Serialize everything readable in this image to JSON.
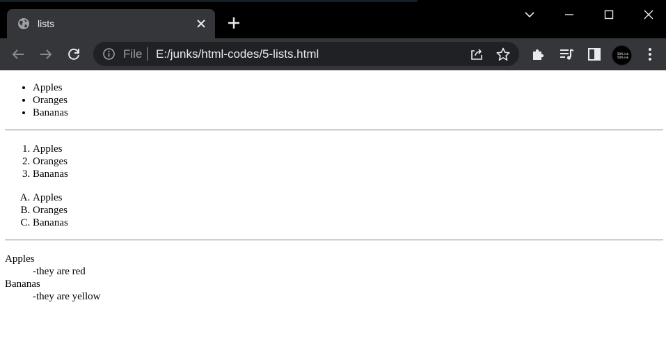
{
  "tab": {
    "title": "lists"
  },
  "omnibox": {
    "scheme": "File",
    "url": "E:/junks/html-codes/5-lists.html"
  },
  "avatar": {
    "line1": "50% ink",
    "line2": "50% ink"
  },
  "page": {
    "unordered": [
      "Apples",
      "Oranges",
      "Bananas"
    ],
    "ordered_numeric": [
      "Apples",
      "Oranges",
      "Bananas"
    ],
    "ordered_alpha": [
      "Apples",
      "Oranges",
      "Bananas"
    ],
    "definitions": [
      {
        "term": "Apples",
        "desc": "-they are red"
      },
      {
        "term": "Bananas",
        "desc": "-they are yellow"
      }
    ]
  },
  "icons": {
    "favicon": "globe-icon",
    "tab_close": "close-icon",
    "new_tab": "plus-icon",
    "tab_search": "chevron-down-icon",
    "minimize": "minimize-icon",
    "maximize": "maximize-icon",
    "close": "close-icon",
    "back": "arrow-left-icon",
    "forward": "arrow-right-icon",
    "reload": "reload-icon",
    "info": "info-icon",
    "share": "share-icon",
    "bookmark": "star-icon",
    "extensions": "puzzle-icon",
    "media": "media-queue-icon",
    "side_panel": "side-panel-icon",
    "menu": "kebab-menu-icon"
  },
  "colors": {
    "titlebar": "#000000",
    "toolbar": "#35363a",
    "omnibox": "#202124",
    "text_light": "#e8eaed",
    "text_dim": "#9aa0a6"
  }
}
